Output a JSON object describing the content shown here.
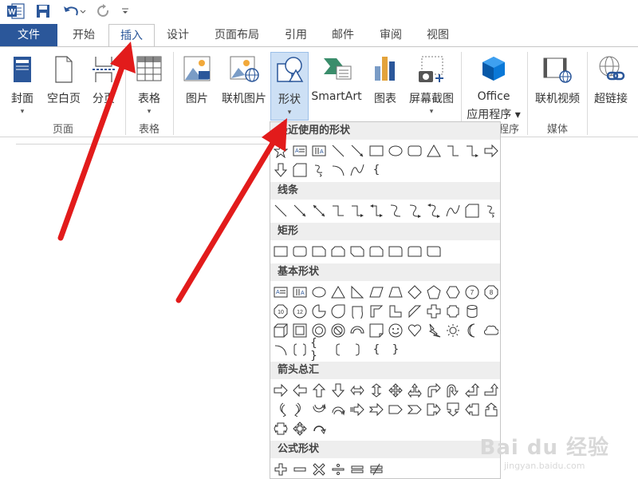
{
  "quick_access": {
    "app_icon": "word-logo-icon",
    "save_icon": "save-icon",
    "undo_icon": "undo-icon",
    "redo_icon": "redo-icon",
    "more_icon": "customize-qat-icon"
  },
  "tabs": [
    {
      "label": "文件"
    },
    {
      "label": "开始"
    },
    {
      "label": "插入"
    },
    {
      "label": "设计"
    },
    {
      "label": "页面布局"
    },
    {
      "label": "引用"
    },
    {
      "label": "邮件"
    },
    {
      "label": "审阅"
    },
    {
      "label": "视图"
    }
  ],
  "ribbon": {
    "buttons": {
      "cover": "封面",
      "blank_page": "空白页",
      "page_break": "分页",
      "table": "表格",
      "picture": "图片",
      "online_picture": "联机图片",
      "shapes": "形状",
      "smartart": "SmartArt",
      "chart": "图表",
      "screenshot": "屏幕截图",
      "office_line1": "Office",
      "office_line2": "应用程序",
      "online_video": "联机视频",
      "hyperlink": "超链接"
    },
    "groups": {
      "pages": "页面",
      "tables": "表格",
      "apps_partial": "程序",
      "media": "媒体"
    }
  },
  "shapes_menu": {
    "sections": {
      "recent": "最近使用的形状",
      "lines": "线条",
      "rectangles": "矩形",
      "basic": "基本形状",
      "arrows": "箭头总汇",
      "equation": "公式形状"
    }
  },
  "watermark": {
    "brand": "Bai du 经验",
    "url": "jingyan.baidu.com"
  },
  "colors": {
    "accent": "#2b579a",
    "selected": "#cde0f5",
    "arrow": "#e21b1b"
  }
}
